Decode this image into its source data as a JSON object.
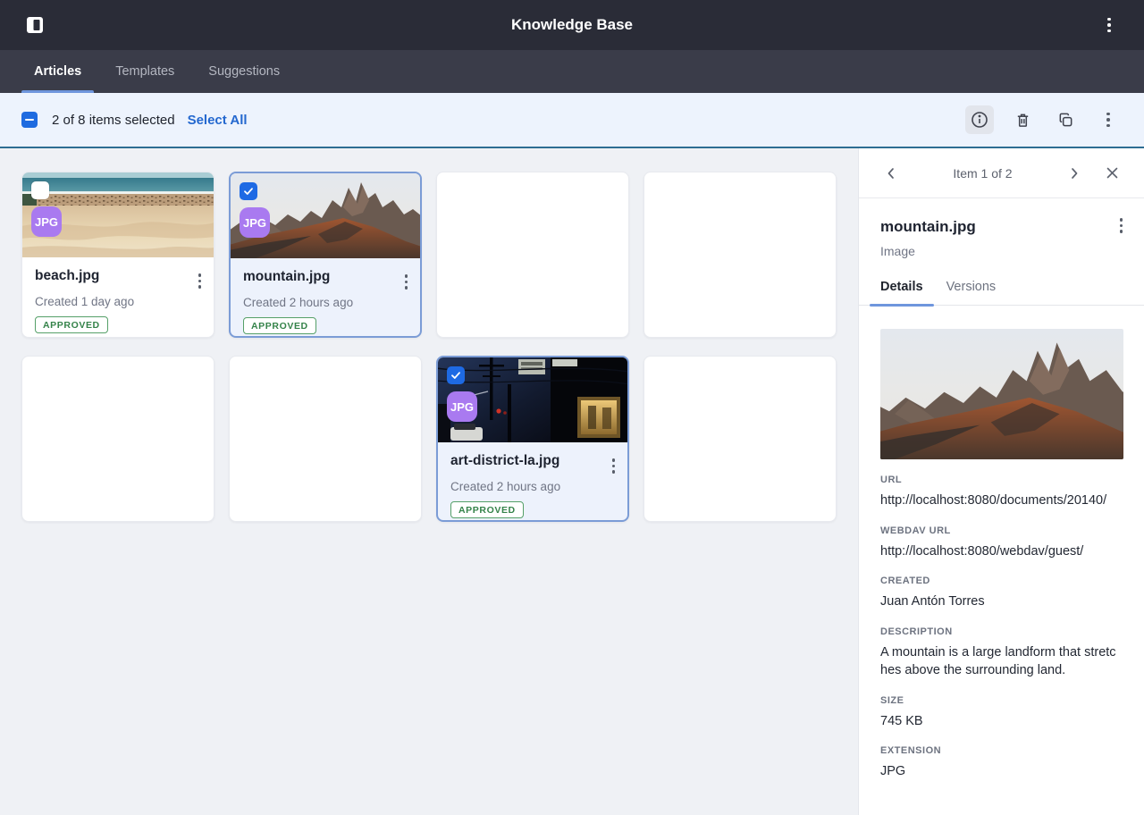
{
  "header": {
    "title": "Knowledge Base"
  },
  "tabs": [
    {
      "label": "Articles",
      "active": true
    },
    {
      "label": "Templates",
      "active": false
    },
    {
      "label": "Suggestions",
      "active": false
    }
  ],
  "toolbar": {
    "selection_text": "2 of 8 items selected",
    "select_all_label": "Select All",
    "icons": [
      "info-icon",
      "trash-icon",
      "copy-icon",
      "kebab-icon"
    ]
  },
  "cards": [
    {
      "filename": "beach.jpg",
      "created": "Created 1 day ago",
      "status": "APPROVED",
      "type_badge": "JPG",
      "checked": false,
      "selected": false
    },
    {
      "filename": "mountain.jpg",
      "created": "Created 2 hours ago",
      "status": "APPROVED",
      "type_badge": "JPG",
      "checked": true,
      "selected": true
    },
    {
      "filename": "art-district-la.jpg",
      "created": "Created 2 hours ago",
      "status": "APPROVED",
      "type_badge": "JPG",
      "checked": true,
      "selected": true
    }
  ],
  "panel": {
    "pager": "Item 1 of 2",
    "title": "mountain.jpg",
    "subtitle": "Image",
    "tabs": [
      {
        "label": "Details",
        "active": true
      },
      {
        "label": "Versions",
        "active": false
      }
    ],
    "fields": [
      {
        "label": "URL",
        "value": "http://localhost:8080/documents/20140/"
      },
      {
        "label": "WEBDAV URL",
        "value": "http://localhost:8080/webdav/guest/"
      },
      {
        "label": "CREATED",
        "value": "Juan Antón Torres"
      },
      {
        "label": "DESCRIPTION",
        "value": "A mountain is a large landform that stretches above the surrounding land."
      },
      {
        "label": "SIZE",
        "value": "745 KB"
      },
      {
        "label": "EXTENSION",
        "value": "JPG"
      }
    ]
  },
  "colors": {
    "header_bg": "#2a2c37",
    "tabbar_bg": "#3a3c49",
    "toolbar_bg": "#edf3fd",
    "toolbar_divider": "#2d6d92",
    "accent_blue": "#1f6be0",
    "tab_underline": "#6f96dd",
    "selected_card_border": "#7b9cd6",
    "approved_green": "#35834a",
    "jpg_badge_purple": "#a97af0"
  }
}
